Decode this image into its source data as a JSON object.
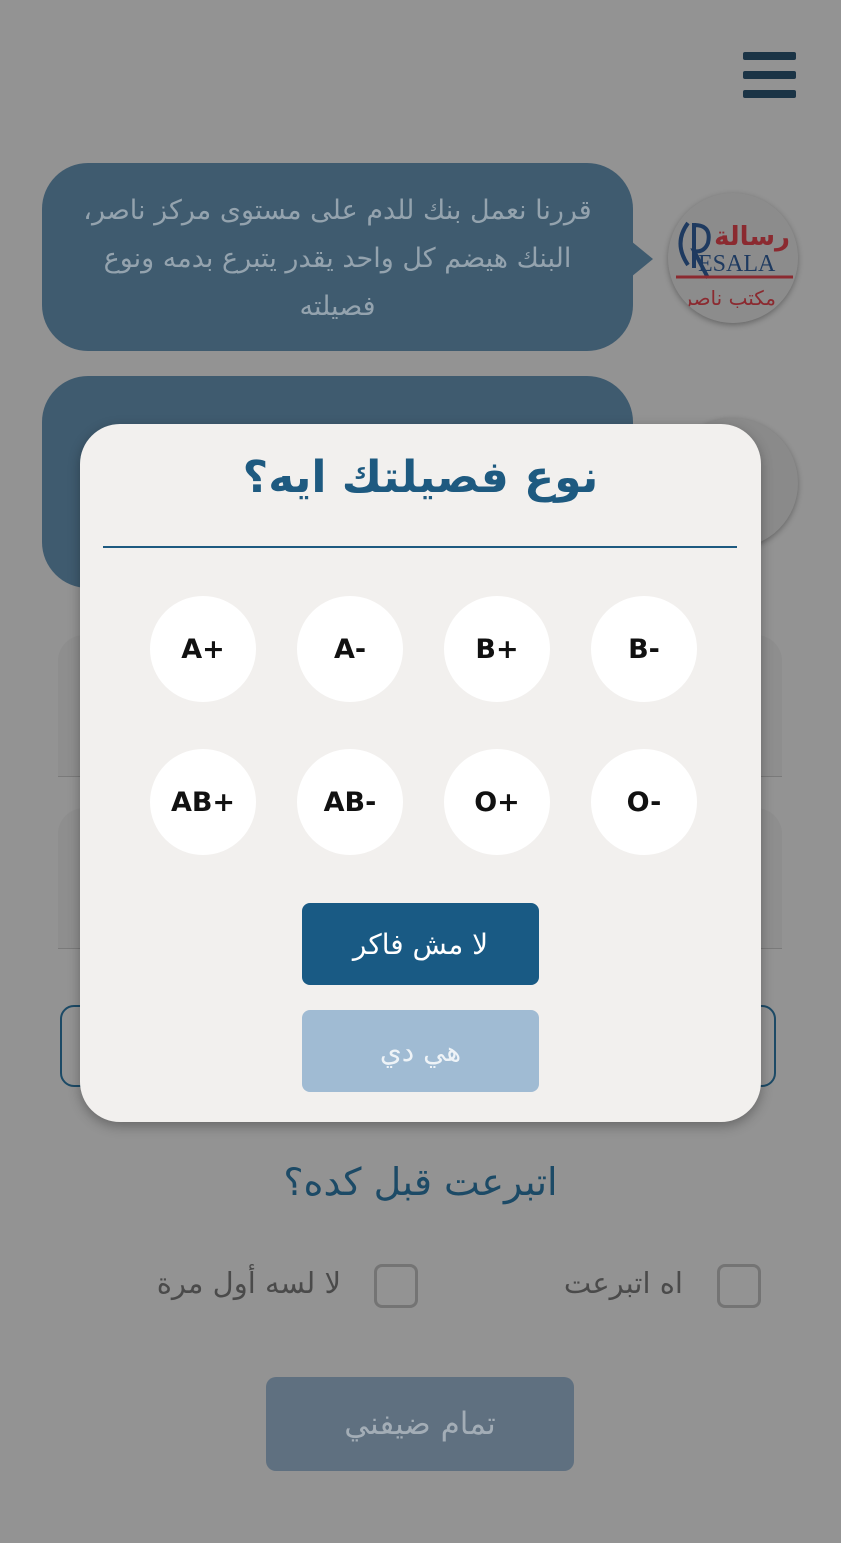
{
  "header": {
    "menu_icon": "hamburger-menu-icon"
  },
  "chat": {
    "messages": [
      {
        "text": "قررنا نعمل بنك للدم على مستوى مركز ناصر، البنك هيضم كل واحد يقدر يتبرع بدمه ونوع فصيلته"
      },
      {
        "text": ""
      }
    ],
    "avatar_logo": "رسالة RESALA مكتب ناصر"
  },
  "modal": {
    "title": "نوع فصيلتك ايه؟",
    "blood_types": [
      "A+",
      "A-",
      "B+",
      "B-",
      "AB+",
      "AB-",
      "O+",
      "O-"
    ],
    "dont_remember_label": "لا مش فاكر",
    "confirm_label": "هي دي"
  },
  "form": {
    "donated_question": "اتبرعت قبل كده؟",
    "option_yes": "اه اتبرعت",
    "option_no": "لا لسه أول مرة",
    "submit_label": "تمام ضيفني"
  },
  "colors": {
    "primary": "#195a84",
    "primary_light": "#a0bbd3",
    "modal_bg": "#f2f0ee"
  }
}
